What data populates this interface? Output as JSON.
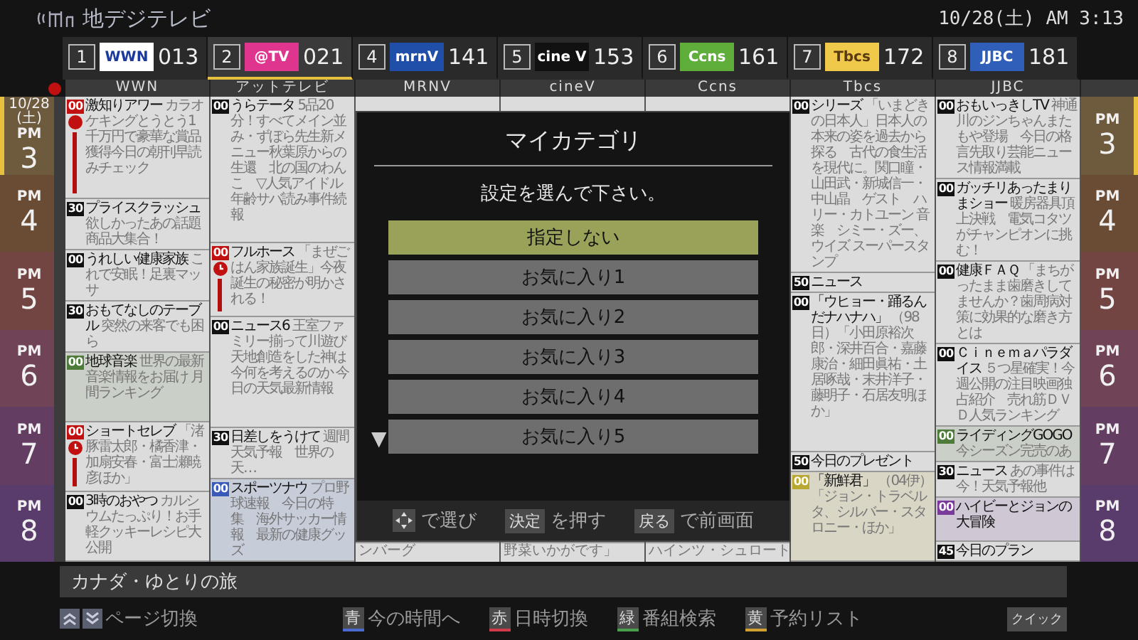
{
  "header": {
    "title": "地デジテレビ",
    "datetime": "10/28(土) AM 3:13"
  },
  "channels": [
    {
      "number": "1",
      "logo": "WWN",
      "color": "#ffffff",
      "code": "013",
      "name": "WWN",
      "selected": false
    },
    {
      "number": "2",
      "logo": "@TV",
      "color": "#e0358f",
      "code": "021",
      "name": "アットテレビ",
      "selected": true
    },
    {
      "number": "4",
      "logo": "mrnV",
      "color": "#1f4fa8",
      "code": "141",
      "name": "MRNV",
      "selected": false
    },
    {
      "number": "5",
      "logo": "cine V",
      "color": "#111111",
      "code": "153",
      "name": "cineV",
      "selected": false
    },
    {
      "number": "6",
      "logo": "Ccns",
      "color": "#5fae3c",
      "code": "161",
      "name": "Ccns",
      "selected": false
    },
    {
      "number": "7",
      "logo": "Tbcs",
      "color": "#f0c84a",
      "code": "172",
      "name": "Tbcs",
      "selected": false
    },
    {
      "number": "8",
      "logo": "JJBC",
      "color": "#2f5fb8",
      "code": "181",
      "name": "JJBC",
      "selected": false
    }
  ],
  "left_time": {
    "date": "10/28",
    "weekday": "(土)",
    "hours": [
      {
        "period": "PM",
        "hour": "3",
        "current": true
      },
      {
        "period": "PM",
        "hour": "4",
        "current": false
      },
      {
        "period": "PM",
        "hour": "5",
        "current": false
      },
      {
        "period": "PM",
        "hour": "6",
        "current": false
      },
      {
        "period": "PM",
        "hour": "7",
        "current": false
      },
      {
        "period": "PM",
        "hour": "8",
        "current": false
      }
    ]
  },
  "right_time": {
    "hours": [
      {
        "period": "PM",
        "hour": "3",
        "current": true
      },
      {
        "period": "PM",
        "hour": "4",
        "current": false
      },
      {
        "period": "PM",
        "hour": "5",
        "current": false
      },
      {
        "period": "PM",
        "hour": "6",
        "current": false
      },
      {
        "period": "PM",
        "hour": "7",
        "current": false
      },
      {
        "period": "PM",
        "hour": "8",
        "current": false
      }
    ]
  },
  "columns": [
    {
      "programs": [
        {
          "kind": "program",
          "start": "00",
          "recording": true,
          "record_mark": true,
          "title": "激知りアワー",
          "desc": "カラオケキングとうとう1千万円で豪華な賞品獲得今日の朝刊早読みチェック"
        },
        {
          "kind": "program",
          "start": "30",
          "recording": false,
          "title": "プライスクラッシュ",
          "desc": "欲しかったあの話題商品大集合！"
        },
        {
          "kind": "program",
          "start": "00",
          "recording": false,
          "title": "うれしい健康家族",
          "desc": "これで安眠！足裏マッサ"
        },
        {
          "kind": "program",
          "start": "30",
          "recording": false,
          "title": "おもてなしのテーブル",
          "desc": "突然の来客でも困ら"
        },
        {
          "kind": "program",
          "start": "00",
          "recording": false,
          "color": "#4e7a3a",
          "title": "地球音楽",
          "desc": "世界の最新音楽情報をお届け 月間ランキング"
        },
        {
          "kind": "program",
          "start": "00",
          "recording": true,
          "timer_mark": true,
          "title": "ショートセレブ",
          "desc": "「渚豚雷太郎・橘香津・加扇安春・富士瀬暁彦ほか」"
        },
        {
          "kind": "program",
          "start": "00",
          "recording": false,
          "title": "3時のおやつ",
          "desc": "カルシウムたっぷり！お手軽クッキーレシピ大公開"
        }
      ]
    },
    {
      "programs": [
        {
          "kind": "program",
          "start": "00",
          "recording": false,
          "title": "うらテータ",
          "desc": "5品20分！すべてメイン並み・ずぼら先生新メニュー秋葉原からの生還　北の国のわんこ　▽人気アイドル年齢サバ読み事件続報"
        },
        {
          "kind": "program",
          "start": "00",
          "recording": true,
          "timer_mark": true,
          "title": "フルホース",
          "desc": "「まぜごはん家族誕生」今夜誕生の秘密が明かされる！"
        },
        {
          "kind": "program",
          "start": "00",
          "recording": false,
          "title": "ニュース6",
          "desc": "王室ファミリー揃って川遊び天地創造をした神は今何を考えるのか 今日の天気最新情報"
        },
        {
          "kind": "program",
          "start": "30",
          "recording": false,
          "title": "日差しをうけて",
          "desc": "週間天気予報　世界の天…"
        },
        {
          "kind": "program",
          "start": "00",
          "recording": false,
          "color": "#3a5ab8",
          "title": "スポーツナウ",
          "desc": "プロ野球速報　今日の特集　海外サッカー情報　最新の健康グッズ"
        }
      ]
    },
    {
      "programs": [
        {
          "kind": "hidden"
        },
        {
          "kind": "tail",
          "desc": "ンバーグ"
        }
      ]
    },
    {
      "programs": [
        {
          "kind": "hidden"
        },
        {
          "kind": "tail",
          "desc": "野菜いかがです」"
        }
      ]
    },
    {
      "programs": [
        {
          "kind": "hidden"
        },
        {
          "kind": "tail",
          "desc": "ハインツ・シュロート"
        }
      ]
    },
    {
      "programs": [
        {
          "kind": "program",
          "start": "00",
          "recording": false,
          "title": "シリーズ",
          "desc": "「いまどきの日本人」日本人の本来の姿を過去から探る　古代の食生活を現代に。関口瞳・山田武・新城信一・中山晶　ゲスト　ハリー・カトユーン 音楽　シミー・ズー、ウイズ スーパースタンプ"
        },
        {
          "kind": "program",
          "start": "50",
          "recording": false,
          "title": "ニュース"
        },
        {
          "kind": "program",
          "start": "00",
          "recording": false,
          "title": "「ウヒョー・踊るんだナハナハ」",
          "desc": "（98日）「小田原裕次郎・深井百合・嘉藤康治・細田眞祐・土居啄哉・末井洋子・藤明子・石居友明ほか」"
        },
        {
          "kind": "program",
          "start": "50",
          "recording": false,
          "title": "今日のプレゼント"
        },
        {
          "kind": "program",
          "start": "00",
          "recording": false,
          "color": "#b8a830",
          "title": "「新鮮君」",
          "desc": "（04伊）「ジョン・トラベルタ、シルバー・スタロニー・ほか」"
        }
      ]
    },
    {
      "programs": [
        {
          "kind": "program",
          "start": "00",
          "recording": false,
          "title": "おもいっきしTV",
          "desc": "神通川のジンちゃんまたもや登場　今日の格言先取り芸能ニュース情報満載"
        },
        {
          "kind": "program",
          "start": "00",
          "recording": false,
          "title": "ガッチリあったまりまショー",
          "desc": "暖房器具頂上決戦　電気コタツがチャンピオンに挑む！"
        },
        {
          "kind": "program",
          "start": "00",
          "recording": false,
          "title": "健康ＦＡＱ",
          "desc": "「まちがったまま歯磨きしてませんか？歯周病対策に効果的な磨き方とは"
        },
        {
          "kind": "program",
          "start": "00",
          "recording": false,
          "title": "Ｃｉｎｅｍａパラダイス",
          "desc": "５つ星確実！今週公開の注目映画独占紹介　売れ筋ＤＶＤ人気ランキング"
        },
        {
          "kind": "program",
          "start": "00",
          "recording": false,
          "color": "#4e7a3a",
          "title": "ライディングGOGO",
          "desc": "今シーズン完売のあ"
        },
        {
          "kind": "program",
          "start": "30",
          "recording": false,
          "title": "ニュース",
          "desc": "あの事件は今！天気予報他"
        },
        {
          "kind": "program",
          "start": "00",
          "recording": false,
          "color": "#7a3a9a",
          "title": "ハイビーとジョンの大冒険"
        },
        {
          "kind": "program",
          "start": "45",
          "recording": false,
          "title": "今日のプラン"
        }
      ]
    }
  ],
  "dialog": {
    "title": "マイカテゴリ",
    "prompt": "設定を選んで下さい。",
    "scroll_arrow": "▼",
    "options": [
      {
        "label": "指定しない",
        "selected": true
      },
      {
        "label": "お気に入り1",
        "selected": false
      },
      {
        "label": "お気に入り2",
        "selected": false
      },
      {
        "label": "お気に入り3",
        "selected": false
      },
      {
        "label": "お気に入り4",
        "selected": false
      },
      {
        "label": "お気に入り5",
        "selected": false
      }
    ],
    "hints": [
      {
        "kind": "dpad",
        "text": "で選び"
      },
      {
        "kind": "key",
        "key": "決定",
        "text": "を押す"
      },
      {
        "kind": "key",
        "key": "戻る",
        "text": "で前画面"
      }
    ]
  },
  "info_bar": "カナダ・ゆとりの旅",
  "footer": {
    "page_label": "ページ切換",
    "keys": [
      {
        "key": "青",
        "label": "今の時間へ",
        "color": "#4a6ad0"
      },
      {
        "key": "赤",
        "label": "日時切換",
        "color": "#d03a4a"
      },
      {
        "key": "緑",
        "label": "番組検索",
        "color": "#4aa04a"
      },
      {
        "key": "黄",
        "label": "予約リスト",
        "color": "#d0a030"
      }
    ],
    "quick": "クイック"
  }
}
